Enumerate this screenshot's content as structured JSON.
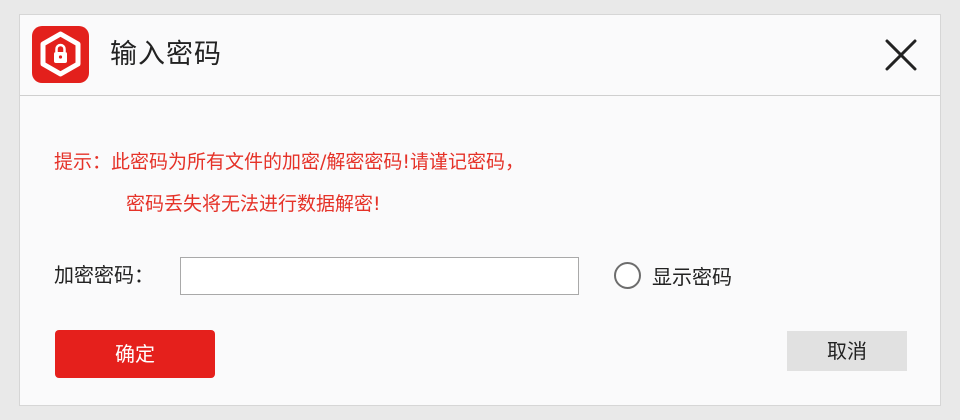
{
  "window": {
    "title": "输入密码",
    "logo_icon": "shield-lock-logo-icon",
    "close_icon": "close-icon"
  },
  "hint": {
    "line1": "提示：此密码为所有文件的加密/解密密码!请谨记密码，",
    "line2": "密码丢失将无法进行数据解密!",
    "color": "#e53228"
  },
  "form": {
    "password_label": "加密密码：",
    "password_value": "",
    "show_password_label": "显示密码",
    "show_password_checked": false
  },
  "buttons": {
    "ok_label": "确定",
    "cancel_label": "取消"
  },
  "colors": {
    "accent": "#e5201c",
    "dialog_bg": "#fafafb",
    "cancel_bg": "#e1e1e1"
  }
}
